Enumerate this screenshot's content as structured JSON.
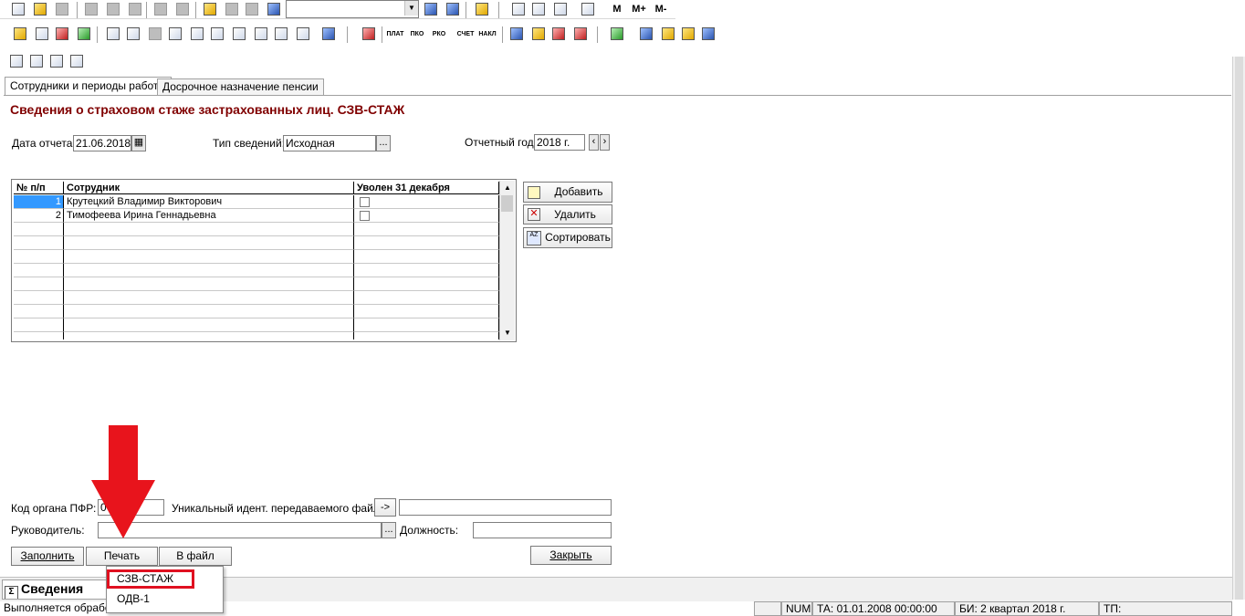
{
  "toolbar": {
    "row1_text_buttons": [
      "M",
      "M+",
      "M-"
    ],
    "row2_text_buttons": [
      "ПЛАТ",
      "ПКО",
      "РКО",
      "СЧЕТ",
      "НАКЛ"
    ]
  },
  "tabs": [
    {
      "label": "Сотрудники и периоды работы"
    },
    {
      "label": "Досрочное назначение пенсии"
    }
  ],
  "form": {
    "title": "Сведения о страховом стаже застрахованных лиц. СЗВ-СТАЖ",
    "report_date_label": "Дата отчета:",
    "report_date_value": "21.06.2018",
    "info_type_label": "Тип сведений:",
    "info_type_value": "Исходная",
    "report_year_label": "Отчетный год:",
    "report_year_value": "2018 г."
  },
  "table": {
    "headers": [
      "№ п/п",
      "Сотрудник",
      "Уволен 31 декабря"
    ],
    "rows": [
      {
        "num": "1",
        "name": "Крутецкий Владимир Викторович"
      },
      {
        "num": "2",
        "name": "Тимофеева Ирина Геннадьевна"
      }
    ]
  },
  "side_buttons": {
    "add": "Добавить",
    "delete": "Удалить",
    "sort": "Сортировать"
  },
  "bottom": {
    "pfr_label": "Код органа ПФР:",
    "pfr_value": "0",
    "file_id_label": "Уникальный идент. передаваемого файла:",
    "arrow_label": "->",
    "manager_label": "Руководитель:",
    "position_label": "Должность:",
    "fill_button": "Заполнить",
    "print_button": "Печать",
    "file_button": "В файл",
    "close_button": "Закрыть"
  },
  "print_menu": {
    "items": [
      "СЗВ-СТАЖ",
      "ОДВ-1"
    ],
    "highlight_color": "#e01020"
  },
  "taskbar": {
    "doc_label": "Сведения"
  },
  "status_bar": {
    "processing": "Выполняется обработка",
    "num": "NUM",
    "ta": "ТА: 01.01.2008  00:00:00",
    "bi": "БИ: 2 квартал 2018 г.",
    "tp": "ТП:"
  },
  "annotation": {
    "arrow_color": "#e8141c"
  }
}
